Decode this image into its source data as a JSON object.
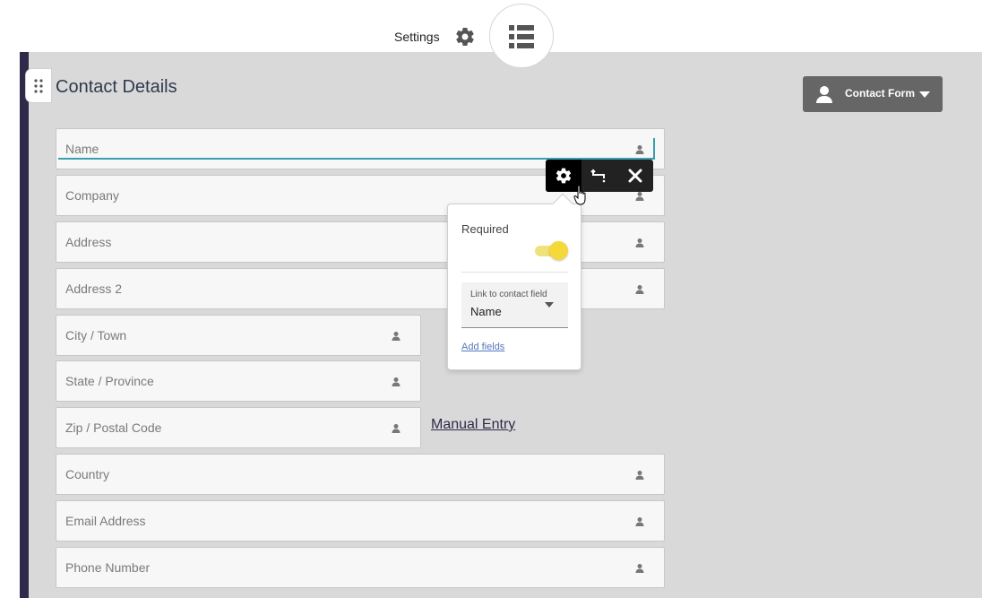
{
  "header": {
    "settings_label": "Settings",
    "settings_icon": "gear-icon",
    "view_icon": "list-icon"
  },
  "section": {
    "title": "Contact Details",
    "drag_icon": "drag-handle-icon"
  },
  "contact_form_button": {
    "label": "Contact Form",
    "icon": "person-icon"
  },
  "fields": [
    {
      "placeholder": "Name",
      "active": true
    },
    {
      "placeholder": "Company"
    },
    {
      "placeholder": "Address"
    },
    {
      "placeholder": "Address 2"
    },
    {
      "placeholder": "City / Town"
    },
    {
      "placeholder": "State / Province"
    },
    {
      "placeholder": "Zip / Postal Code"
    },
    {
      "placeholder": "Country"
    },
    {
      "placeholder": "Email Address"
    },
    {
      "placeholder": "Phone Number"
    }
  ],
  "manual_entry_link": "Manual Entry",
  "field_toolbar": {
    "icons": [
      "gear-icon",
      "branch-icon",
      "close-icon"
    ]
  },
  "field_settings_popup": {
    "required_label": "Required",
    "required_enabled": true,
    "link_label": "Link to contact field",
    "link_value": "Name",
    "add_fields_link": "Add fields"
  },
  "colors": {
    "accent_strip": "#2f2a4a",
    "active_underline": "#3aa0b0",
    "toggle_on": "#f5d83a",
    "contact_form_button_bg": "#666666",
    "main_background": "#d9d9d9"
  }
}
